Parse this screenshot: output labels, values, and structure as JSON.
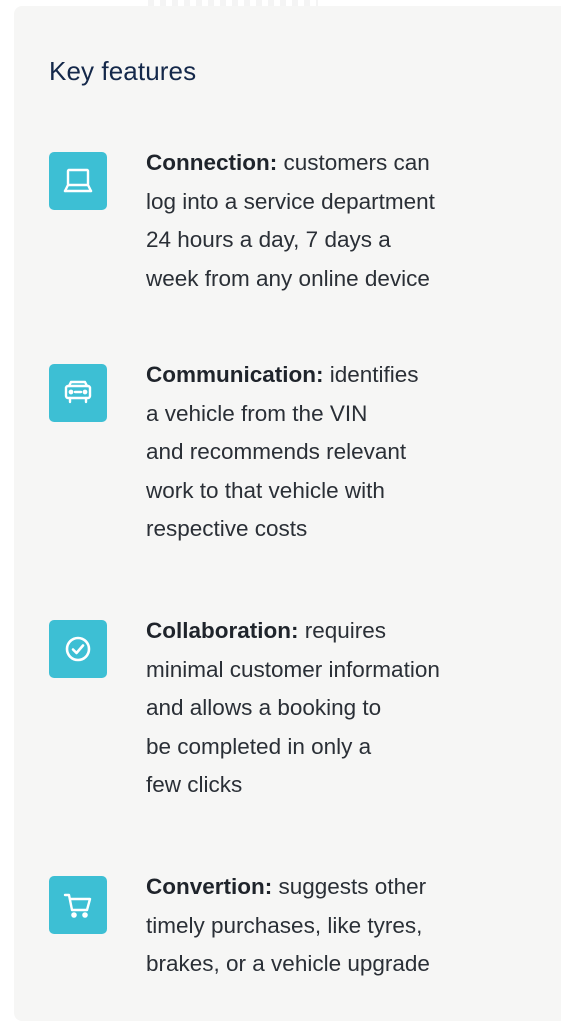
{
  "title": "Key features",
  "accent_color": "#3dbfd4",
  "features": [
    {
      "icon": "laptop-icon",
      "lead": "Connection:",
      "lines": [
        " customers can",
        "log into a service department",
        "24 hours a day, 7 days a",
        "week from any online device"
      ]
    },
    {
      "icon": "car-icon",
      "lead": "Communication:",
      "lines": [
        " identifies",
        "a vehicle from the VIN",
        "and recommends relevant",
        "work to that vehicle with",
        "respective costs"
      ]
    },
    {
      "icon": "check-circle-icon",
      "lead": "Collaboration:",
      "lines": [
        " requires",
        "minimal customer information",
        "and allows a booking to",
        "be completed in only a",
        "few clicks"
      ]
    },
    {
      "icon": "cart-icon",
      "lead": "Convertion:",
      "lines": [
        " suggests other",
        "timely purchases, like tyres,",
        "brakes, or a vehicle upgrade"
      ]
    }
  ]
}
